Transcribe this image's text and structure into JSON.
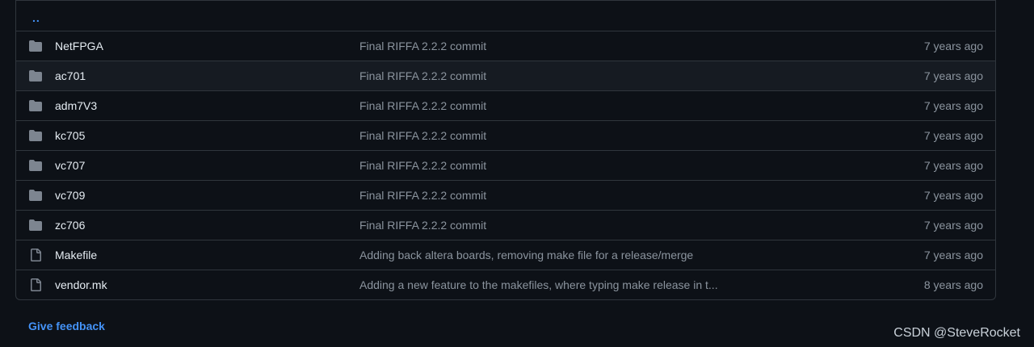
{
  "parent_link": "..",
  "rows": [
    {
      "name": "NetFPGA",
      "type": "folder",
      "commit": "Final RIFFA 2.2.2 commit",
      "age": "7 years ago"
    },
    {
      "name": "ac701",
      "type": "folder",
      "commit": "Final RIFFA 2.2.2 commit",
      "age": "7 years ago"
    },
    {
      "name": "adm7V3",
      "type": "folder",
      "commit": "Final RIFFA 2.2.2 commit",
      "age": "7 years ago"
    },
    {
      "name": "kc705",
      "type": "folder",
      "commit": "Final RIFFA 2.2.2 commit",
      "age": "7 years ago"
    },
    {
      "name": "vc707",
      "type": "folder",
      "commit": "Final RIFFA 2.2.2 commit",
      "age": "7 years ago"
    },
    {
      "name": "vc709",
      "type": "folder",
      "commit": "Final RIFFA 2.2.2 commit",
      "age": "7 years ago"
    },
    {
      "name": "zc706",
      "type": "folder",
      "commit": "Final RIFFA 2.2.2 commit",
      "age": "7 years ago"
    },
    {
      "name": "Makefile",
      "type": "file",
      "commit": "Adding back altera boards, removing make file for a release/merge",
      "age": "7 years ago"
    },
    {
      "name": "vendor.mk",
      "type": "file",
      "commit": "Adding a new feature to the makefiles, where typing make release in t...",
      "age": "8 years ago"
    }
  ],
  "feedback_label": "Give feedback",
  "watermark": "CSDN @SteveRocket",
  "colors": {
    "background": "#0d1117",
    "border": "#30363d",
    "link": "#4493f8",
    "muted": "#8b949e",
    "text": "#e6edf3",
    "folder_icon": "#7d8590"
  },
  "icons": {
    "folder": "folder-icon",
    "file": "file-icon"
  }
}
